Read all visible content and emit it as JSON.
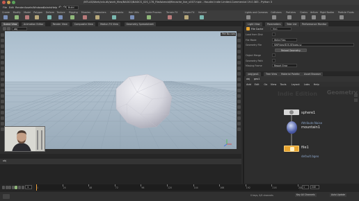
{
  "window": {
    "title": "/NTLAS/Work/cdv-dk/work_files/BASICS/BASICS_02S_178_FileAsteroid/filecache_live_v007.hiplc - Houdini Indie Limited-Commercial 19.0.383 - Python 3"
  },
  "menu": {
    "items": [
      "File",
      "Edit",
      "Render",
      "Assets",
      "Windows",
      "Solaris",
      "Help"
    ],
    "desktop": "Build",
    "icons": [
      "undo-icon",
      "redo-icon"
    ]
  },
  "shelf": {
    "tabs_left": [
      "Create",
      "Modify",
      "Model",
      "Polygon",
      "Deform",
      "Texture",
      "Rigging",
      "Muscles",
      "Characters",
      "Constraints",
      "Hair Utils",
      "Guide Process",
      "Terrain FX",
      "Simple FX",
      "Volume"
    ],
    "tabs_right": [
      "Lights and Cameras",
      "Collisions",
      "Particles",
      "Grains",
      "Vellum",
      "Rigid Bodies",
      "Particle Fluids",
      "Viscous Fluids",
      "Oceans",
      "Pyro FX",
      "FEM",
      "Wires",
      "Crowds",
      "Drive Simulation"
    ]
  },
  "viewport": {
    "tabs": [
      "Scene View",
      "Animation Editor",
      "Render View",
      "Composite View",
      "Motion FX View",
      "Geometry Spreadsheet"
    ],
    "active_tab": "Scene View",
    "path": "obj",
    "camera_label": "Persp",
    "cam_menu": "No cam",
    "timestamp_label": "Indie Edition"
  },
  "parameters": {
    "tabs": [
      "Light View",
      "Parameters",
      "Take List",
      "Performance Monitor"
    ],
    "node_type": "File Cache",
    "node_name": "file1",
    "rows": [
      {
        "label": "Load from Disk",
        "value": ""
      },
      {
        "label": "File Mode",
        "value": "Write Files"
      },
      {
        "label": "Geometry File",
        "value": "$HIP/geo/$OS.$F.bgeo.sc"
      },
      {
        "label": "",
        "value": "Reload Geometry"
      },
      {
        "label": "Object Merge",
        "value": ""
      },
      {
        "label": "Geometry Path",
        "value": ""
      },
      {
        "label": "Missing Frame",
        "value": "Report Error"
      }
    ]
  },
  "network": {
    "tabs": [
      "/obj/geo1",
      "Tree View",
      "Material Palette",
      "Asset Browser"
    ],
    "path_obj": "obj",
    "path_geo": "geo1",
    "menu": [
      "Add",
      "Edit",
      "Go",
      "View",
      "Tools",
      "Layout",
      "Labs",
      "Help"
    ],
    "context_label": "Geometry",
    "context_watermark": "Indie Edition",
    "nodes": [
      {
        "name": "sphere1",
        "sub": ""
      },
      {
        "name": "mountain1",
        "sub": "Attribute Noise"
      },
      {
        "name": "file1",
        "sub": "default.bgeo"
      }
    ]
  },
  "timeline": {
    "frame_current": "1",
    "frame_start": "1",
    "frame_end": "240",
    "ticks": [
      "1",
      "24",
      "48",
      "72",
      "96",
      "120",
      "144",
      "168",
      "192",
      "216",
      "240"
    ],
    "fps_label": "24",
    "range_start": "1",
    "range_end": "240"
  },
  "status": {
    "keys": "0 keys, 0/0 channels",
    "key_all": "Key All Channels",
    "auto_update": "Auto Update"
  },
  "colors": {
    "accent": "#f2a23a",
    "node_file": "#e8a530",
    "node_mountain": "#4f5fa8",
    "node_sphere": "#d7d7d7",
    "sky_top": "#a9bccb",
    "ground": "#9fb2c0"
  }
}
